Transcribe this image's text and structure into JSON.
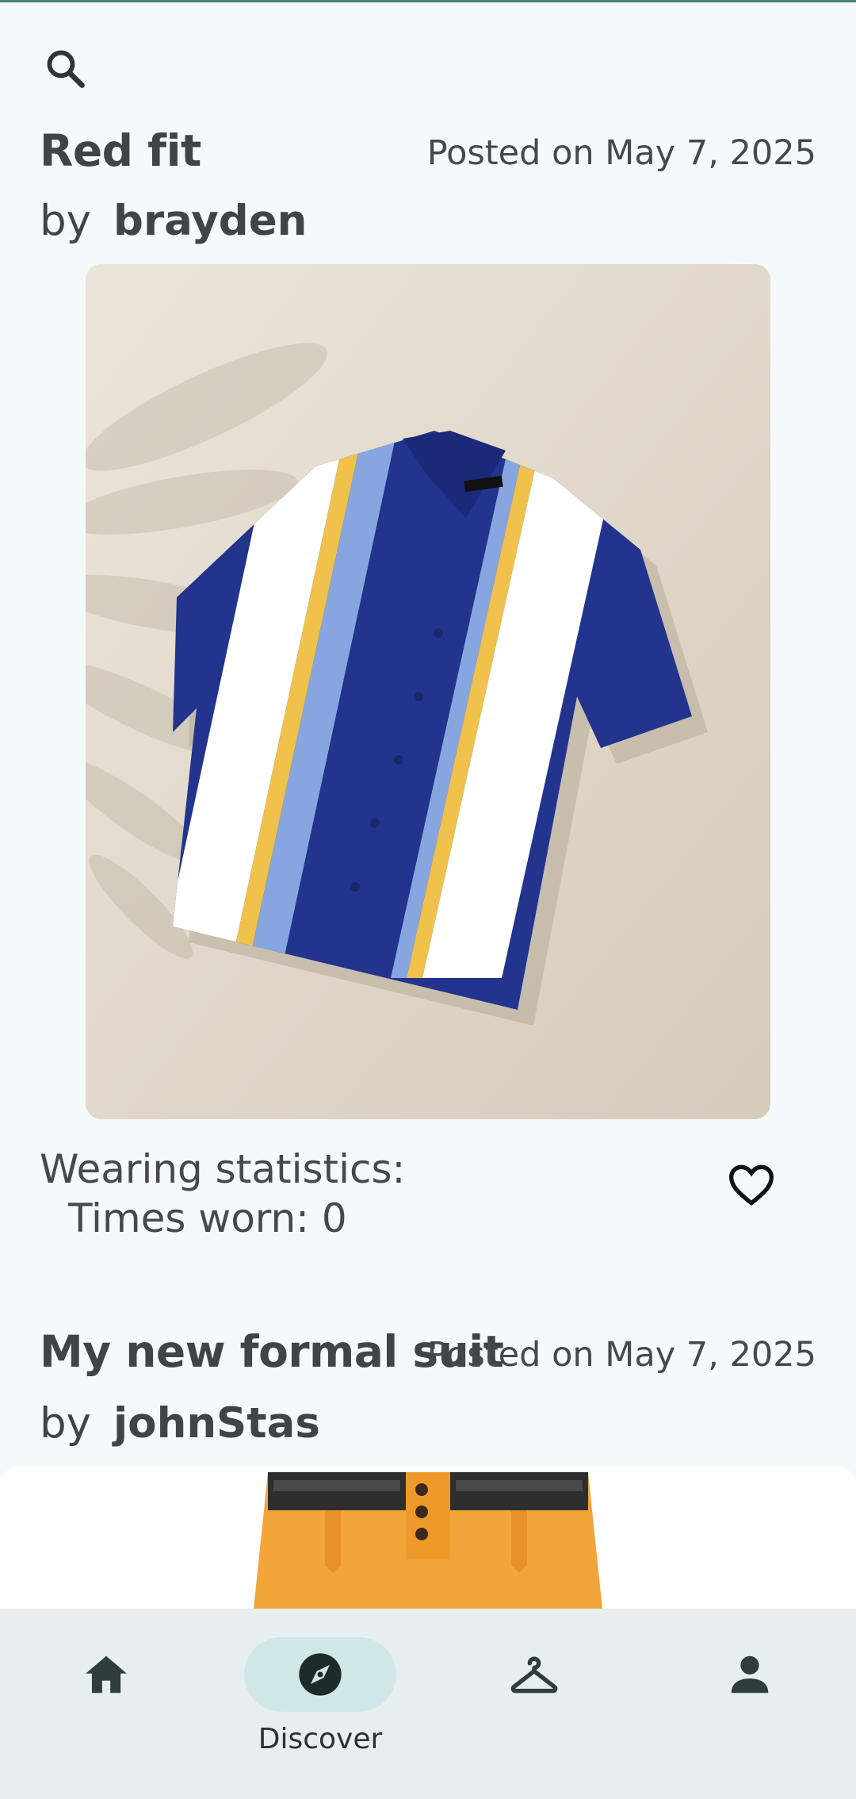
{
  "header": {
    "search_icon": "search-icon"
  },
  "posts": [
    {
      "title": "Red fit",
      "date": "Posted on May 7, 2025",
      "by_label": "by",
      "author": "brayden",
      "stats_heading": "Wearing statistics:",
      "times_worn": "Times worn: 0",
      "like_icon": "heart-outline-icon"
    },
    {
      "title": "My new formal suit",
      "date": "Posted on May 7, 2025",
      "by_label": "by",
      "author": "johnStas"
    }
  ],
  "nav": {
    "items": [
      {
        "icon": "home-icon",
        "label": ""
      },
      {
        "icon": "compass-icon",
        "label": "Discover",
        "active": true
      },
      {
        "icon": "hanger-icon",
        "label": ""
      },
      {
        "icon": "person-icon",
        "label": ""
      }
    ]
  },
  "colors": {
    "background": "#f4fafa",
    "nav_background": "#e8eeee",
    "active_pill": "#cfe7e7",
    "text": "#3f4446"
  }
}
